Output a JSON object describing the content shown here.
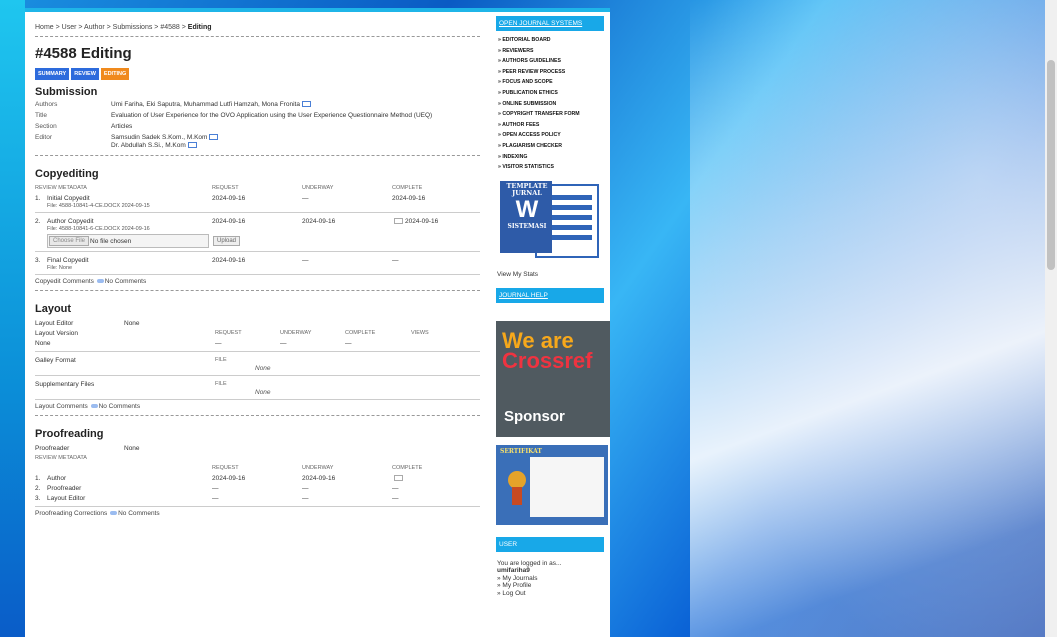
{
  "breadcrumb": {
    "home": "Home",
    "user": "User",
    "author": "Author",
    "submissions": "Submissions",
    "id": "#4588",
    "current": "Editing",
    "sep": " > "
  },
  "title": "#4588 Editing",
  "tabs": [
    {
      "label": "SUMMARY"
    },
    {
      "label": "REVIEW"
    },
    {
      "label": "EDITING"
    }
  ],
  "submission": {
    "heading": "Submission",
    "authors_label": "Authors",
    "authors": "Umi Fariha, Eki Saputra, Muhammad Lutfi Hamzah, Mona Fronita",
    "title_label": "Title",
    "title": "Evaluation of User Experience for the OVO Application using the User Experience Questionnaire Method (UEQ)",
    "section_label": "Section",
    "section": "Articles",
    "editor_label": "Editor",
    "editor1": "Samsudin Sadek S.Kom., M.Kom",
    "editor2": "Dr. Abdullah S.Si., M.Kom"
  },
  "copyediting": {
    "heading": "Copyediting",
    "headers": {
      "meta": "REVIEW METADATA",
      "request": "REQUEST",
      "underway": "UNDERWAY",
      "complete": "COMPLETE"
    },
    "rows": [
      {
        "num": "1.",
        "name": "Initial Copyedit",
        "request": "2024-09-16",
        "underway": "—",
        "complete": "2024-09-16",
        "file": "File: 4588-10841-4-CE.DOCX  2024-09-15"
      },
      {
        "num": "2.",
        "name": "Author Copyedit",
        "request": "2024-09-16",
        "underway": "2024-09-16",
        "complete": "2024-09-16",
        "file": "File: 4588-10841-6-CE.DOCX  2024-09-16"
      },
      {
        "num": "3.",
        "name": "Final Copyedit",
        "request": "2024-09-16",
        "underway": "—",
        "complete": "—",
        "file": "File: None"
      }
    ],
    "choose_file": "Choose File",
    "no_file": "No file chosen",
    "upload": "Upload",
    "comments_label": "Copyedit Comments",
    "comments_value": "No Comments"
  },
  "layout": {
    "heading": "Layout",
    "editor_label": "Layout Editor",
    "editor_value": "None",
    "version_label": "Layout Version",
    "request": "REQUEST",
    "underway": "UNDERWAY",
    "complete": "COMPLETE",
    "views": "VIEWS",
    "version_value": "None",
    "dash1": "—",
    "dash2": "—",
    "dash3": "—",
    "galley_label": "Galley Format",
    "file_hdr": "FILE",
    "galley_none": "None",
    "supp_label": "Supplementary Files",
    "supp_none": "None",
    "comments_label": "Layout Comments",
    "comments_value": "No Comments"
  },
  "proofreading": {
    "heading": "Proofreading",
    "reader_label": "Proofreader",
    "reader_value": "None",
    "headers": {
      "meta": "REVIEW METADATA",
      "request": "REQUEST",
      "underway": "UNDERWAY",
      "complete": "COMPLETE"
    },
    "rows": [
      {
        "num": "1.",
        "name": "Author",
        "request": "2024-09-16",
        "underway": "2024-09-16",
        "complete": ""
      },
      {
        "num": "2.",
        "name": "Proofreader",
        "request": "—",
        "underway": "—",
        "complete": "—"
      },
      {
        "num": "3.",
        "name": "Layout Editor",
        "request": "—",
        "underway": "—",
        "complete": "—"
      }
    ],
    "comments_label": "Proofreading Corrections",
    "comments_value": "No Comments"
  },
  "sidebar": {
    "ojs": "OPEN JOURNAL SYSTEMS",
    "menu": [
      "EDITORIAL BOARD",
      "REVIEWERS",
      "AUTHORS GUIDELINES",
      "PEER REVIEW PROCESS",
      "FOCUS AND SCOPE",
      "PUBLICATION ETHICS",
      "ONLINE SUBMISSION",
      "COPYRIGHT TRANSFER FORM",
      "AUTHOR FEES",
      "OPEN ACCESS POLICY",
      "PLAGIARISM CHECKER",
      "INDEXING",
      "VISITOR STATISTICS"
    ],
    "template_line1": "TEMPLATE",
    "template_line2": "JURNAL",
    "template_letter": "W",
    "template_line3": "SISTEMASI",
    "stats": "View My Stats",
    "help": "JOURNAL HELP",
    "crossref_we": "We are",
    "crossref_name": "Crossref",
    "sponsor": "Sponsor",
    "cert": "SERTIFIKAT",
    "user": "USER",
    "logged": "You are logged in as...",
    "username": "umifariha9",
    "my_journals": "» My Journals",
    "my_profile": "» My Profile",
    "logout": "» Log Out"
  }
}
